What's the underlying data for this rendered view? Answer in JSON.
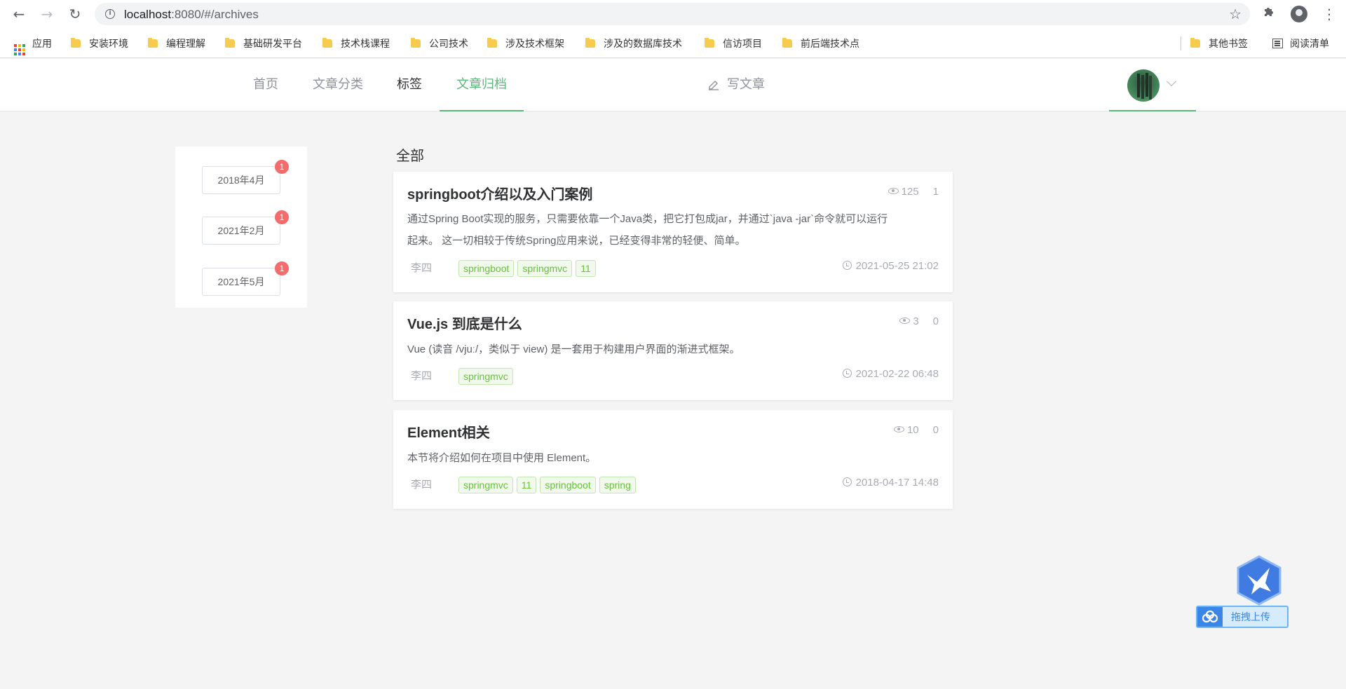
{
  "browser": {
    "url_host": "localhost",
    "url_path": ":8080/#/archives",
    "bookmarks": [
      {
        "label": "应用"
      },
      {
        "label": "安装环境"
      },
      {
        "label": "编程理解"
      },
      {
        "label": "基础研发平台"
      },
      {
        "label": "技术栈课程"
      },
      {
        "label": "公司技术"
      },
      {
        "label": "涉及技术框架"
      },
      {
        "label": "涉及的数据库技术"
      },
      {
        "label": "信访项目"
      },
      {
        "label": "前后端技术点"
      }
    ],
    "other_bookmarks": "其他书签",
    "reading_list": "阅读清单"
  },
  "header": {
    "menu": [
      {
        "label": "首页"
      },
      {
        "label": "文章分类"
      },
      {
        "label": "标签"
      },
      {
        "label": "文章归档"
      }
    ],
    "write_label": "写文章"
  },
  "archives": [
    {
      "label": "2018年4月",
      "count": "1"
    },
    {
      "label": "2021年2月",
      "count": "1"
    },
    {
      "label": "2021年5月",
      "count": "1"
    }
  ],
  "section_title": "全部",
  "articles": [
    {
      "title": "springboot介绍以及入门案例",
      "views": "125",
      "comments": "1",
      "desc_line1": "通过Spring Boot实现的服务，只需要依靠一个Java类，把它打包成jar，并通过`java -jar`命令就可以运行",
      "desc_line2": "起来。 这一切相较于传统Spring应用来说，已经变得非常的轻便、简单。",
      "author": "李四",
      "tags": [
        "springboot",
        "springmvc",
        "11"
      ],
      "date": "2021-05-25 21:02"
    },
    {
      "title": "Vue.js 到底是什么",
      "views": "3",
      "comments": "0",
      "desc_line1": "Vue (读音 /vjuː/，类似于 view) 是一套用于构建用户界面的渐进式框架。",
      "author": "李四",
      "tags": [
        "springmvc"
      ],
      "date": "2021-02-22 06:48"
    },
    {
      "title": "Element相关",
      "views": "10",
      "comments": "0",
      "desc_line1": "本节将介绍如何在项目中使用 Element。",
      "author": "李四",
      "tags": [
        "springmvc",
        "11",
        "springboot",
        "spring"
      ],
      "date": "2018-04-17 14:48"
    }
  ],
  "upload_widget": {
    "label": "拖拽上传"
  },
  "colors": {
    "accent": "#5cb87a",
    "badge": "#f56c6c",
    "tag_text": "#67c23a",
    "tag_bg": "#f0f9eb",
    "upload_blue": "#3a86e6"
  }
}
